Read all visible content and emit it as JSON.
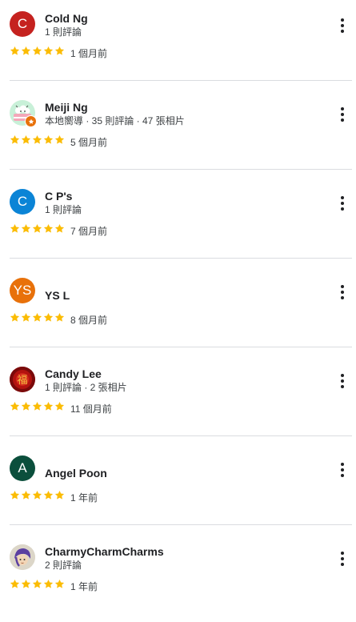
{
  "colors": {
    "star": "#fbbc04",
    "text": "#202124",
    "meta": "#3c4043",
    "divider": "#dadce0"
  },
  "reviews": [
    {
      "name": "Cold Ng",
      "meta": "1 則評論",
      "rating": 5,
      "time": "1 個月前",
      "avatar": {
        "type": "letter",
        "letter": "C",
        "color": "#c5221f"
      }
    },
    {
      "name": "Meiji Ng",
      "meta": "本地嚮導 · 35 則評論 · 47 張相片",
      "rating": 5,
      "time": "5 個月前",
      "avatar": {
        "type": "photo",
        "icon": "cartoon-cake-avatar-icon",
        "color": "#e8f5e9"
      },
      "local_guide": true
    },
    {
      "name": "C P's",
      "meta": "1 則評論",
      "rating": 5,
      "time": "7 個月前",
      "avatar": {
        "type": "letter",
        "letter": "C",
        "color": "#0b84d6"
      }
    },
    {
      "name": "YS L",
      "meta": "",
      "rating": 5,
      "time": "8 個月前",
      "avatar": {
        "type": "letter",
        "letter": "YS",
        "color": "#e8710a"
      }
    },
    {
      "name": "Candy Lee",
      "meta": "1 則評論 · 2 張相片",
      "rating": 5,
      "time": "11 個月前",
      "avatar": {
        "type": "photo",
        "icon": "red-fortune-character-icon",
        "color": "#8b0000"
      }
    },
    {
      "name": "Angel Poon",
      "meta": "",
      "rating": 5,
      "time": "1 年前",
      "avatar": {
        "type": "letter",
        "letter": "A",
        "color": "#0b4f3c"
      }
    },
    {
      "name": "CharmyCharmCharms",
      "meta": "2 則評論",
      "rating": 5,
      "time": "1 年前",
      "avatar": {
        "type": "photo",
        "icon": "purple-hair-character-icon",
        "color": "#d9d4c7"
      }
    }
  ]
}
